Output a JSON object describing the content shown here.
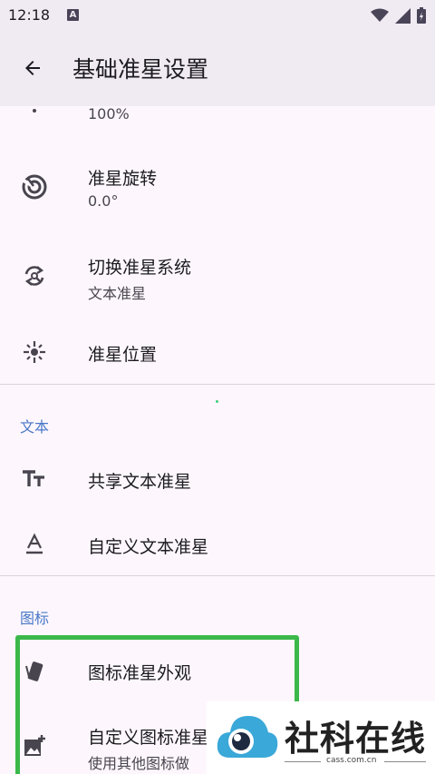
{
  "status_bar": {
    "time": "12:18",
    "notification_icon_letter": "A",
    "icons": [
      "wifi-icon",
      "signal-icon",
      "battery-icon"
    ]
  },
  "app_bar": {
    "back_icon": "arrow-back-icon",
    "title": "基础准星设置"
  },
  "partial_item": {
    "subtitle": "100%"
  },
  "items_top": [
    {
      "icon": "rotate-icon",
      "title": "准星旋转",
      "subtitle": "0.0°"
    },
    {
      "icon": "switch-icon",
      "title": "切换准星系统",
      "subtitle": "文本准星"
    },
    {
      "icon": "position-icon",
      "title": "准星位置",
      "subtitle": ""
    }
  ],
  "section_text": {
    "header": "文本",
    "items": [
      {
        "icon": "text-size-icon",
        "title": "共享文本准星"
      },
      {
        "icon": "text-format-icon",
        "title": "自定义文本准星"
      }
    ]
  },
  "section_icon": {
    "header": "图标",
    "items": [
      {
        "icon": "style-icon",
        "title": "图标准星外观",
        "subtitle": ""
      },
      {
        "icon": "add-photo-icon",
        "title": "自定义图标准星",
        "subtitle": "使用其他图标做"
      }
    ]
  },
  "watermark": {
    "text": "社科在线",
    "domain": "cass.com.cn"
  },
  "colors": {
    "background": "#fdf7fd",
    "appbar": "#f0eaf2",
    "section_header": "#4a78c7",
    "highlight_border": "#3cb84a"
  }
}
